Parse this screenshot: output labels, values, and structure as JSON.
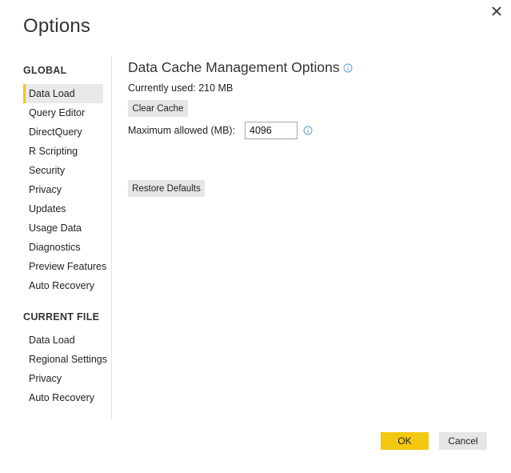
{
  "dialog": {
    "title": "Options",
    "close_icon": "close-icon"
  },
  "sidebar": {
    "global_heading": "GLOBAL",
    "global_items": [
      {
        "label": "Data Load",
        "selected": true
      },
      {
        "label": "Query Editor"
      },
      {
        "label": "DirectQuery"
      },
      {
        "label": "R Scripting"
      },
      {
        "label": "Security"
      },
      {
        "label": "Privacy"
      },
      {
        "label": "Updates"
      },
      {
        "label": "Usage Data"
      },
      {
        "label": "Diagnostics"
      },
      {
        "label": "Preview Features"
      },
      {
        "label": "Auto Recovery"
      }
    ],
    "current_file_heading": "CURRENT FILE",
    "current_file_items": [
      {
        "label": "Data Load"
      },
      {
        "label": "Regional Settings"
      },
      {
        "label": "Privacy"
      },
      {
        "label": "Auto Recovery"
      }
    ]
  },
  "content": {
    "section_title": "Data Cache Management Options",
    "currently_used": "Currently used: 210 MB",
    "clear_cache_label": "Clear Cache",
    "max_allowed_label": "Maximum allowed (MB):",
    "max_allowed_value": "4096",
    "restore_defaults_label": "Restore Defaults"
  },
  "footer": {
    "ok_label": "OK",
    "cancel_label": "Cancel"
  },
  "colors": {
    "accent": "#f2c811",
    "selected_bg": "#e9e9e9",
    "button_bg": "#e6e6e6",
    "info_icon": "#5b9bd5"
  }
}
